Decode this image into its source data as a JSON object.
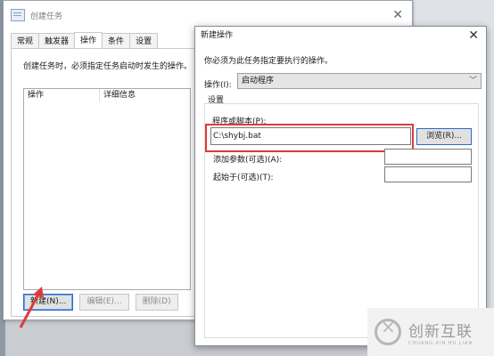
{
  "back_window": {
    "title": "创建任务",
    "close": "✕",
    "tabs": [
      "常规",
      "触发器",
      "操作",
      "条件",
      "设置"
    ],
    "description": "创建任务时，必须指定任务启动时发生的操作。",
    "columns": [
      "操作",
      "详细信息"
    ],
    "buttons": {
      "new": "新建(N)...",
      "edit": "编辑(E)...",
      "delete": "删除(D)"
    }
  },
  "dialog": {
    "title": "新建操作",
    "close": "✕",
    "description": "你必须为此任务指定要执行的操作。",
    "operation_label": "操作(I):",
    "operation_value": "启动程序",
    "settings_label": "设置",
    "program_label": "程序或脚本(P):",
    "program_value": "C:\\shybj.bat",
    "browse_button": "浏览(R)...",
    "arguments_label": "添加参数(可选)(A):",
    "start_in_label": "起始于(可选)(T):"
  },
  "watermark": {
    "cn": "创新互联",
    "en": "CHUANG XIN HU LIAN"
  },
  "colors": {
    "highlight_box": "#e03a3a",
    "arrow": "#e03a3a",
    "focus_blue": "#2b6bc5"
  }
}
